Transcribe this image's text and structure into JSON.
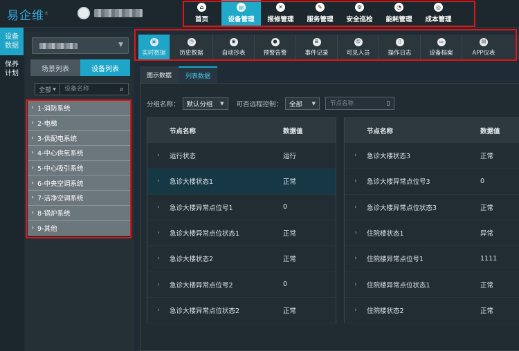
{
  "app": {
    "logo_text": "易企维"
  },
  "topnav": {
    "items": [
      {
        "label": "首页",
        "icon": "home-icon"
      },
      {
        "label": "设备管理",
        "icon": "device-icon",
        "active": true
      },
      {
        "label": "报修管理",
        "icon": "repair-icon"
      },
      {
        "label": "服务管理",
        "icon": "service-icon"
      },
      {
        "label": "安全巡检",
        "icon": "shield-icon"
      },
      {
        "label": "能耗管理",
        "icon": "energy-icon"
      },
      {
        "label": "成本管理",
        "icon": "cost-icon"
      }
    ]
  },
  "vtabs": [
    {
      "label": "设备\n数据",
      "active": true
    },
    {
      "label": "保养\n计划"
    }
  ],
  "left_panel": {
    "tabs": [
      {
        "label": "场景列表"
      },
      {
        "label": "设备列表",
        "active": true
      }
    ],
    "filter_select": "全部",
    "search_placeholder": "设备名称",
    "systems": [
      "1-消防系统",
      "2-电梯",
      "3-供配电系统",
      "4-中心供氧系统",
      "5-中心吸引系统",
      "6-中央空调系统",
      "7-洁净空调系统",
      "8-锅炉系统",
      "9-其他"
    ]
  },
  "toolbar": {
    "items": [
      {
        "label": "实时数据",
        "icon": "realtime-icon",
        "active": true
      },
      {
        "label": "历史数据",
        "icon": "history-icon"
      },
      {
        "label": "自动抄表",
        "icon": "meter-icon"
      },
      {
        "label": "预警告警",
        "icon": "alarm-icon"
      },
      {
        "label": "事件记录",
        "icon": "event-icon"
      },
      {
        "label": "可见人员",
        "icon": "person-icon"
      },
      {
        "label": "操作日志",
        "icon": "log-icon"
      },
      {
        "label": "设备档案",
        "icon": "archive-icon"
      },
      {
        "label": "APP仪表",
        "icon": "app-icon"
      }
    ]
  },
  "view_tabs": [
    {
      "label": "图示数据"
    },
    {
      "label": "列表数据",
      "active": true
    }
  ],
  "filters": {
    "group_label": "分组名称：",
    "group_value": "默认分组",
    "remote_label": "可否远程控制：",
    "remote_value": "全部",
    "node_search_placeholder": "节点名称"
  },
  "tables": {
    "headers": {
      "name": "节点名称",
      "value": "数据值"
    },
    "left": [
      {
        "name": "运行状态",
        "value": "运行"
      },
      {
        "name": "急诊大楼状态1",
        "value": "正常"
      },
      {
        "name": "急诊大楼异常点位号1",
        "value": "0"
      },
      {
        "name": "急诊大楼异常点位状态1",
        "value": "正常"
      },
      {
        "name": "急诊大楼状态2",
        "value": "正常"
      },
      {
        "name": "急诊大楼异常点位号2",
        "value": "0"
      },
      {
        "name": "急诊大楼异常点位状态2",
        "value": "正常"
      }
    ],
    "right": [
      {
        "name": "急诊大楼状态3",
        "value": "正常"
      },
      {
        "name": "急诊大楼异常点位号3",
        "value": "0"
      },
      {
        "name": "急诊大楼异常点位状态3",
        "value": "正常"
      },
      {
        "name": "住院楼状态1",
        "value": "异常"
      },
      {
        "name": "住院楼异常点位号1",
        "value": "1111"
      },
      {
        "name": "住院楼异常点位状态1",
        "value": "正常"
      },
      {
        "name": "住院楼状态2",
        "value": "正常"
      }
    ]
  },
  "colors": {
    "accent": "#1fa5c8",
    "highlight": "#e01515",
    "background": "#1f2c35"
  }
}
